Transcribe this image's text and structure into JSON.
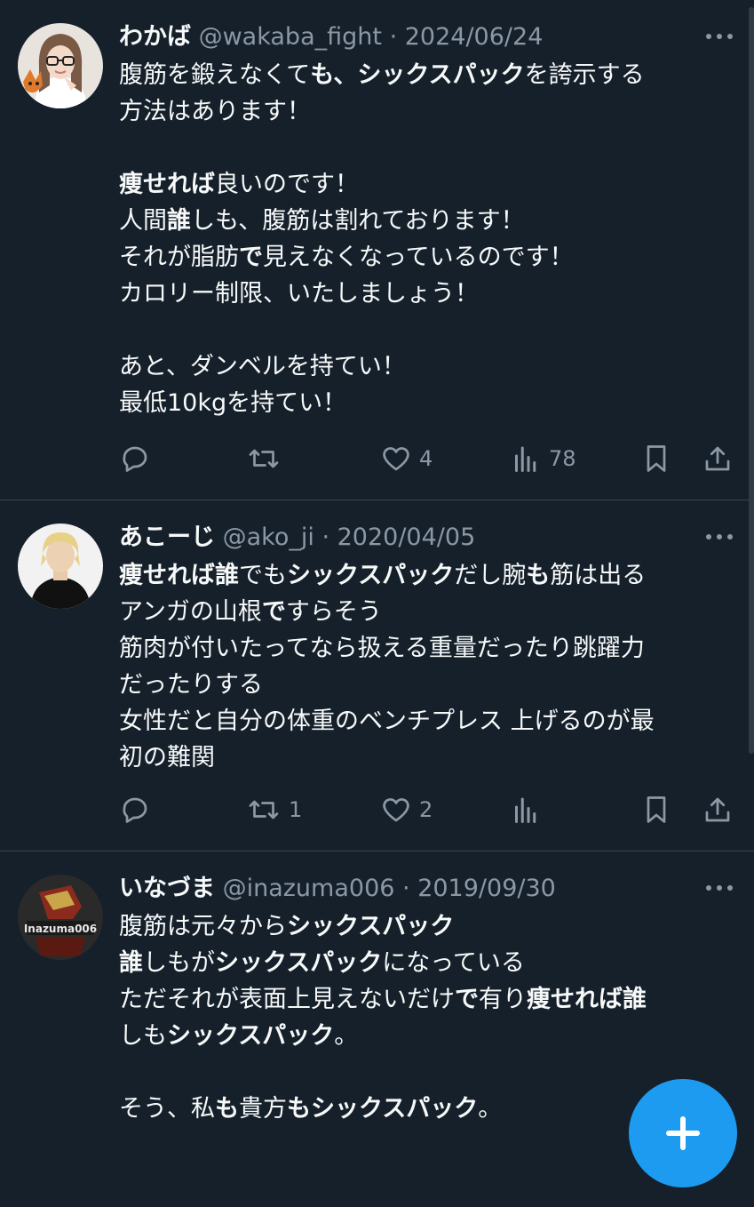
{
  "tweets": [
    {
      "name": "わかば",
      "handle": "@wakaba_fight",
      "separator": "·",
      "date": "2024/06/24",
      "lines": [
        [
          [
            "腹筋を鍛えなくて",
            0
          ],
          [
            "も、シックスパック",
            1
          ],
          [
            "を誇示する",
            0
          ]
        ],
        [
          [
            "方法はあります！",
            0
          ]
        ],
        [],
        [
          [
            "痩せれば",
            1
          ],
          [
            "良いのです！",
            0
          ]
        ],
        [
          [
            "人間",
            0
          ],
          [
            "誰",
            1
          ],
          [
            "しも、腹筋は割れております！",
            0
          ]
        ],
        [
          [
            "それが脂肪",
            0
          ],
          [
            "で",
            1
          ],
          [
            "見えなくなっているのです！",
            0
          ]
        ],
        [
          [
            "カロリー制限、いたしましょう！",
            0
          ]
        ],
        [],
        [
          [
            "あと、ダンベルを持てい！",
            0
          ]
        ],
        [
          [
            "最低10kgを持てい！",
            0
          ]
        ]
      ],
      "stats": {
        "reply": "",
        "retweet": "",
        "like": "4",
        "views": "78"
      }
    },
    {
      "name": "あこーじ",
      "handle": "@ako_ji",
      "separator": "·",
      "date": "2020/04/05",
      "lines": [
        [
          [
            "痩せれば誰",
            1
          ],
          [
            "でも",
            0
          ],
          [
            "シックスパック",
            1
          ],
          [
            "だし腕",
            0
          ],
          [
            "も",
            1
          ],
          [
            "筋は出る",
            0
          ]
        ],
        [
          [
            "アンガの山根",
            0
          ],
          [
            "で",
            1
          ],
          [
            "すらそう",
            0
          ]
        ],
        [
          [
            "筋肉が付いたってなら扱える重量だったり跳躍力",
            0
          ]
        ],
        [
          [
            "だったりする",
            0
          ]
        ],
        [
          [
            "女性だと自分の体重のベンチプレス 上げるのが最",
            0
          ]
        ],
        [
          [
            "初の難関",
            0
          ]
        ]
      ],
      "stats": {
        "reply": "",
        "retweet": "1",
        "like": "2",
        "views": ""
      }
    },
    {
      "name": "いなづま",
      "handle": "@inazuma006",
      "separator": "·",
      "date": "2019/09/30",
      "lines": [
        [
          [
            "腹筋は元々から",
            0
          ],
          [
            "シックスパック",
            1
          ]
        ],
        [
          [
            "誰",
            1
          ],
          [
            "しもが",
            0
          ],
          [
            "シックスパック",
            1
          ],
          [
            "になっている",
            0
          ]
        ],
        [
          [
            "ただそれが表面上見えないだけ",
            0
          ],
          [
            "で",
            1
          ],
          [
            "有り",
            0
          ],
          [
            "痩せれば誰",
            1
          ]
        ],
        [
          [
            "しも",
            0
          ],
          [
            "シックスパック",
            1
          ],
          [
            "。",
            0
          ]
        ],
        [],
        [
          [
            "そう、私",
            0
          ],
          [
            "も",
            1
          ],
          [
            "貴方",
            0
          ],
          [
            "もシックスパック",
            1
          ],
          [
            "。",
            0
          ]
        ]
      ],
      "stats": {
        "reply": "",
        "retweet": "",
        "like": "",
        "views": ""
      }
    }
  ],
  "avatar_labels": {
    "inazuma": "Inazuma006"
  },
  "icons": [
    "reply-icon",
    "retweet-icon",
    "like-icon",
    "views-icon",
    "bookmark-icon",
    "share-icon",
    "more-icon",
    "compose-icon"
  ],
  "colors": {
    "background": "#15202b",
    "text": "#f7f9f9",
    "muted": "#8b98a5",
    "accent": "#1d9bf0",
    "divider": "#38444d"
  }
}
